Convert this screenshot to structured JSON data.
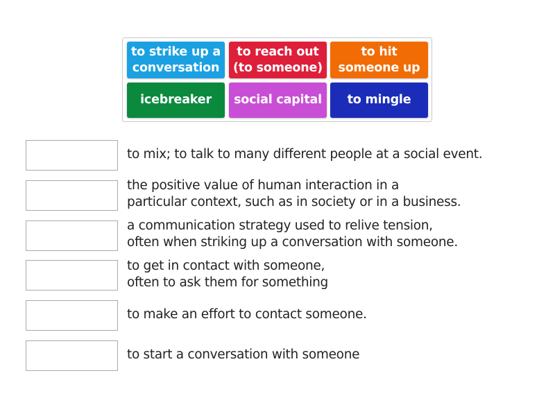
{
  "word_bank": {
    "tiles": [
      {
        "label_line1": "to strike up a",
        "label_line2": "conversation",
        "color": "#1ba1e2"
      },
      {
        "label_line1": "to reach out",
        "label_line2": "(to someone)",
        "color": "#de1f3a"
      },
      {
        "label_line1": "to hit",
        "label_line2": "someone up",
        "color": "#f26c05"
      },
      {
        "label_line1": "icebreaker",
        "label_line2": "",
        "color": "#0b8a3e"
      },
      {
        "label_line1": "social capital",
        "label_line2": "",
        "color": "#c94ed6"
      },
      {
        "label_line1": "to mingle",
        "label_line2": "",
        "color": "#1b2db8"
      }
    ]
  },
  "matches": [
    {
      "line1": "to mix; to talk to many different people at a social event.",
      "line2": ""
    },
    {
      "line1": "the positive value of human interaction in a",
      "line2": "particular context, such as in society or in a business."
    },
    {
      "line1": "a communication strategy used to relive tension,",
      "line2": "often when striking up a conversation with someone."
    },
    {
      "line1": "to get in contact with someone,",
      "line2": "often to ask them for something"
    },
    {
      "line1": "to make an effort to contact someone.",
      "line2": ""
    },
    {
      "line1": "to start a conversation with someone",
      "line2": ""
    }
  ]
}
